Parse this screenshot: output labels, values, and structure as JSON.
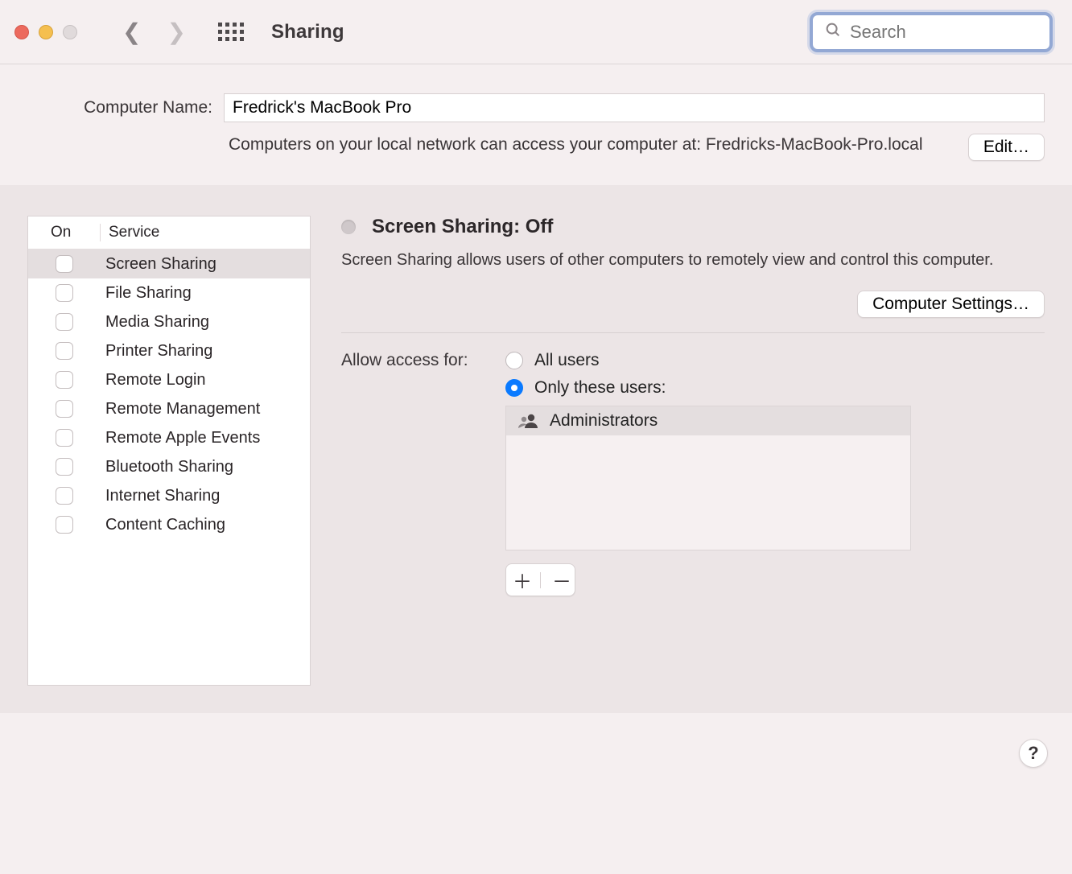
{
  "title": "Sharing",
  "search": {
    "placeholder": "Search"
  },
  "computer_name": {
    "label": "Computer Name:",
    "value": "Fredrick's MacBook Pro",
    "subline": "Computers on your local network can access your computer at: Fredricks-MacBook-Pro.local",
    "edit_label": "Edit…"
  },
  "sidebar": {
    "header_on": "On",
    "header_service": "Service",
    "items": [
      {
        "label": "Screen Sharing",
        "checked": false,
        "selected": true
      },
      {
        "label": "File Sharing",
        "checked": false,
        "selected": false
      },
      {
        "label": "Media Sharing",
        "checked": false,
        "selected": false
      },
      {
        "label": "Printer Sharing",
        "checked": false,
        "selected": false
      },
      {
        "label": "Remote Login",
        "checked": false,
        "selected": false
      },
      {
        "label": "Remote Management",
        "checked": false,
        "selected": false
      },
      {
        "label": "Remote Apple Events",
        "checked": false,
        "selected": false
      },
      {
        "label": "Bluetooth Sharing",
        "checked": false,
        "selected": false
      },
      {
        "label": "Internet Sharing",
        "checked": false,
        "selected": false
      },
      {
        "label": "Content Caching",
        "checked": false,
        "selected": false
      }
    ]
  },
  "detail": {
    "status_title": "Screen Sharing: Off",
    "status_desc": "Screen Sharing allows users of other computers to remotely view and control this computer.",
    "computer_settings_label": "Computer Settings…",
    "access_label": "Allow access for:",
    "radio_all": "All users",
    "radio_only": "Only these users:",
    "radio_selected": "only",
    "users": [
      {
        "name": "Administrators"
      }
    ]
  },
  "help_label": "?"
}
